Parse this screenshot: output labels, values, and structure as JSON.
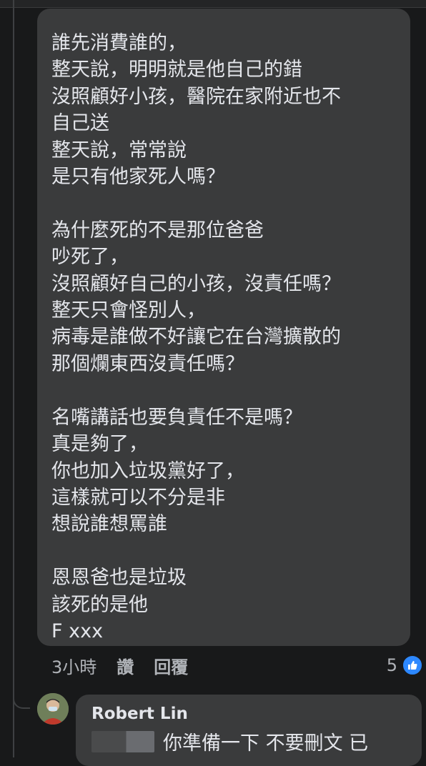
{
  "comment": {
    "text": "誰先消費誰的，\n整天說，明明就是他自己的錯\n沒照顧好小孩，醫院在家附近也不\n自己送\n整天說，常常說\n是只有他家死人嗎？\n\n為什麼死的不是那位爸爸\n吵死了，\n沒照顧好自己的小孩，沒責任嗎？\n整天只會怪別人，\n病毒是誰做不好讓它在台灣擴散的\n那個爛東西沒責任嗎？\n\n名嘴講話也要負責任不是嗎？\n真是夠了，\n你也加入垃圾黨好了，\n這樣就可以不分是非\n想說誰想罵誰\n\n恩恩爸也是垃圾\n該死的是他\nF xxx",
    "meta": {
      "time": "3小時",
      "like_label": "讚",
      "reply_label": "回覆"
    },
    "reaction_count": "5",
    "reaction_icon": "thumbs-up-icon",
    "reaction_color": "#2d88ff"
  },
  "reply": {
    "author": "Robert Lin",
    "text": "你準備一下 不要刪文 已"
  },
  "colors": {
    "background": "#18191a",
    "bubble": "#3a3b3c",
    "text": "#e4e6eb",
    "secondary_text": "#b0b3b8"
  }
}
